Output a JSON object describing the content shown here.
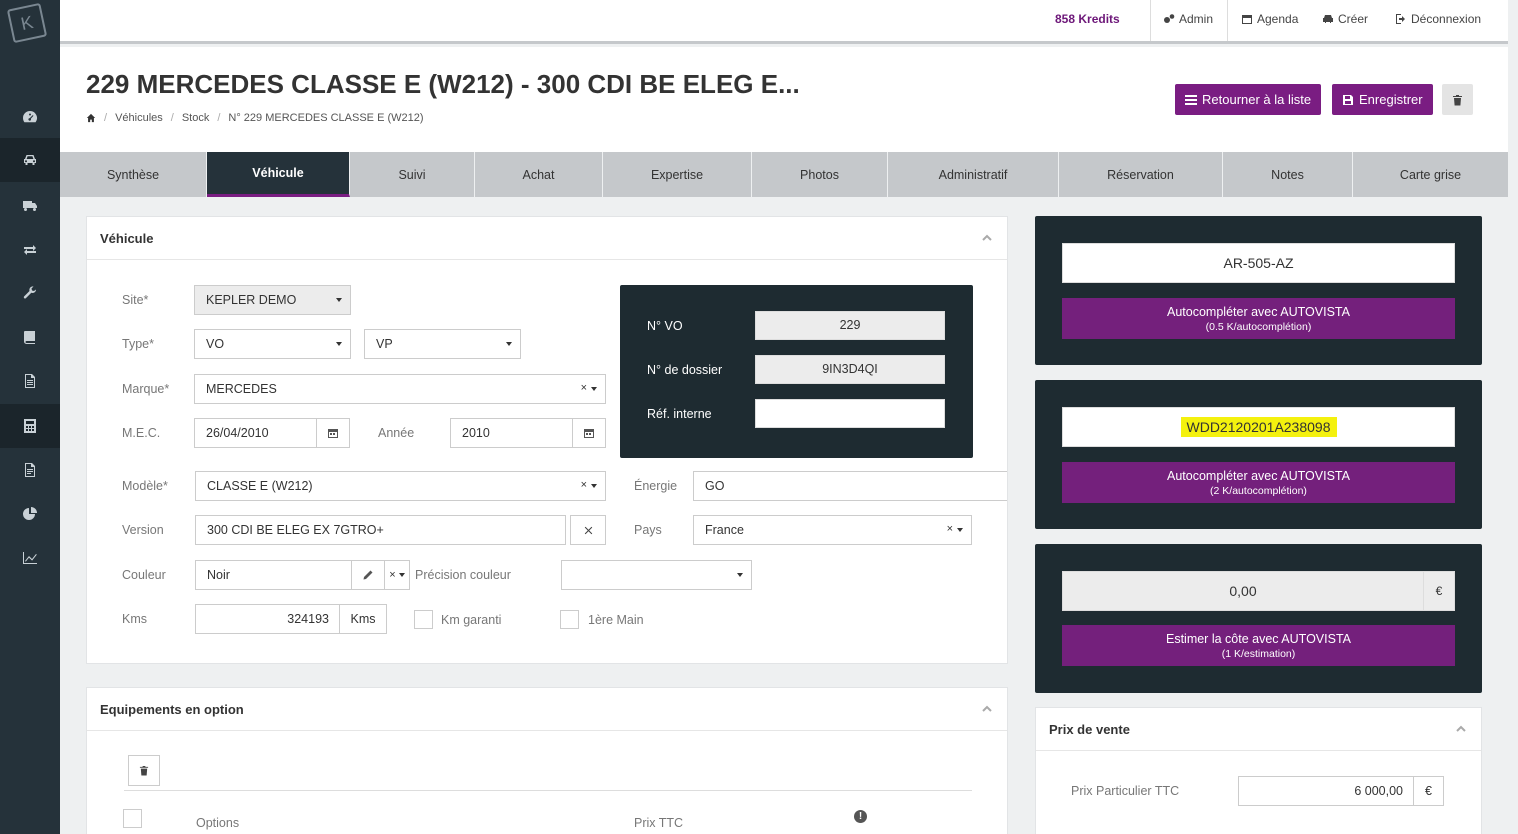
{
  "header": {
    "kredits": "858 Kredits",
    "nav": [
      {
        "label": "Admin",
        "icon": "gears-icon"
      },
      {
        "label": "Agenda",
        "icon": "calendar-icon"
      },
      {
        "label": "Créer",
        "icon": "car-icon"
      },
      {
        "label": "Déconnexion",
        "icon": "signout-icon"
      }
    ]
  },
  "sidebar": {
    "logo": "K",
    "items": [
      {
        "icon": "dashboard-icon"
      },
      {
        "icon": "car-icon"
      },
      {
        "icon": "truck-icon"
      },
      {
        "icon": "exchange-icon"
      },
      {
        "icon": "wrench-icon"
      },
      {
        "icon": "book-icon"
      },
      {
        "icon": "document-icon"
      },
      {
        "icon": "calculator-icon"
      },
      {
        "icon": "file-icon"
      },
      {
        "icon": "pie-chart-icon"
      },
      {
        "icon": "line-chart-icon"
      }
    ]
  },
  "page": {
    "title": "229 MERCEDES CLASSE E (W212) - 300 CDI BE ELEG E...",
    "breadcrumb": [
      "Véhicules",
      "Stock",
      "N° 229 MERCEDES CLASSE E (W212)"
    ],
    "btn_back": "Retourner à la liste",
    "btn_save": "Enregistrer"
  },
  "tabs": [
    "Synthèse",
    "Véhicule",
    "Suivi",
    "Achat",
    "Expertise",
    "Photos",
    "Administratif",
    "Réservation",
    "Notes",
    "Carte grise"
  ],
  "vehicule": {
    "title": "Véhicule",
    "site_label": "Site*",
    "site_value": "KEPLER DEMO",
    "type_label": "Type*",
    "type_value": "VO",
    "type2_value": "VP",
    "marque_label": "Marque*",
    "marque_value": "MERCEDES",
    "mec_label": "M.E.C.",
    "mec_value": "26/04/2010",
    "annee_label": "Année",
    "annee_value": "2010",
    "modele_label": "Modèle*",
    "modele_value": "CLASSE E (W212)",
    "energie_label": "Énergie",
    "energie_value": "GO",
    "version_label": "Version",
    "version_value": "300 CDI BE ELEG  EX  7GTRO+",
    "pays_label": "Pays",
    "pays_value": "France",
    "couleur_label": "Couleur",
    "couleur_value": "Noir",
    "precision_label": "Précision couleur",
    "precision_value": "",
    "kms_label": "Kms",
    "kms_value": "324193",
    "kms_unit": "Kms",
    "km_garanti": "Km garanti",
    "premiere_main": "1ère Main",
    "nvo_label": "N° VO",
    "nvo_value": "229",
    "dossier_label": "N° de dossier",
    "dossier_value": "9IN3D4QI",
    "ref_label": "Réf. interne",
    "ref_value": ""
  },
  "equipements": {
    "title": "Equipements en option",
    "col_options": "Options",
    "col_prix": "Prix TTC"
  },
  "autovista": {
    "plate": "AR-505-AZ",
    "btn1": "Autocompléter avec AUTOVISTA",
    "btn1_sub": "(0.5 K/autocomplétion)",
    "vin": "WDD2120201A238098",
    "btn2": "Autocompléter avec AUTOVISTA",
    "btn2_sub": "(2 K/autocomplétion)",
    "cote_value": "0,00",
    "currency": "€",
    "btn3": "Estimer la côte avec AUTOVISTA",
    "btn3_sub": "(1 K/estimation)"
  },
  "prix": {
    "title": "Prix de vente",
    "particulier_label": "Prix Particulier TTC",
    "particulier_value": "6 000,00",
    "currency": "€"
  },
  "colors": {
    "accent": "#7a1d82",
    "dark": "#1e2b31",
    "sidebar": "#25323a",
    "highlight": "#f4f10e"
  }
}
